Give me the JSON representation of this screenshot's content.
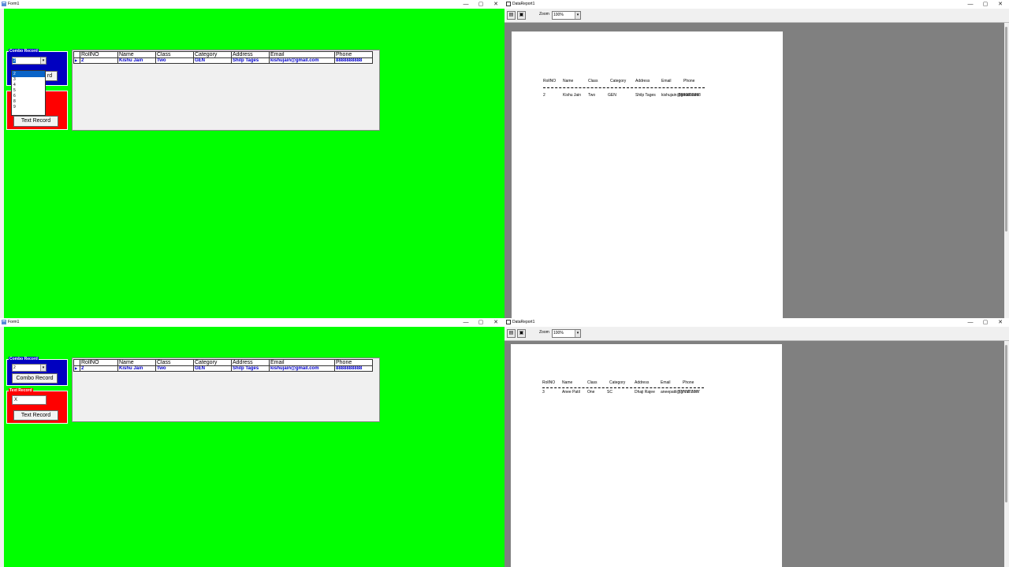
{
  "top": {
    "form": {
      "title": "Form1",
      "controls": {
        "minimize": "—",
        "maximize": "▢",
        "close": "✕"
      },
      "combo_frame": {
        "label": "Combo Record",
        "selected": "2",
        "button": "Combo Record",
        "button_visible_fragment": "rd"
      },
      "dropdown": {
        "options": [
          "2",
          "3",
          "4",
          "5",
          "6",
          "8",
          "9",
          "10"
        ],
        "selected_index": 0
      },
      "text_frame": {
        "label": "Text Record",
        "button": "Text Record"
      },
      "grid": {
        "indicator": "▶",
        "headers": [
          "RollNO",
          "Name",
          "Class",
          "Category",
          "Address",
          "Email",
          "Phone"
        ],
        "row": [
          "2",
          "Kishu Jain",
          "Two",
          "GEN",
          "Shilp Tages",
          "kishujain@gmail.com",
          "8888888888"
        ]
      }
    },
    "report": {
      "title": "DataReport1",
      "controls": {
        "minimize": "—",
        "maximize": "▢",
        "close": "✕"
      },
      "toolbar": {
        "print_icon": "printer-icon",
        "export_icon": "export-icon",
        "zoom_label": "Zoom",
        "zoom_value": "100%"
      },
      "headers": [
        "RollNO",
        "Name",
        "Class",
        "Category",
        "Address",
        "Email",
        "Phone"
      ],
      "row": [
        "2",
        "Kishu Jain",
        "Two",
        "GEN",
        "Shilp Tages",
        "kishujain@gmail.com",
        "8888888888"
      ]
    }
  },
  "bottom": {
    "form": {
      "title": "Form1",
      "controls": {
        "minimize": "—",
        "maximize": "▢",
        "close": "✕"
      },
      "combo_frame": {
        "label": "Combo Record",
        "selected": "2",
        "button": "Combo Record"
      },
      "text_frame": {
        "label": "Text Record",
        "input_value": "X",
        "button": "Text Record"
      },
      "grid": {
        "indicator": "▶",
        "headers": [
          "RollNO",
          "Name",
          "Class",
          "Category",
          "Address",
          "Email",
          "Phone"
        ],
        "row": [
          "2",
          "Kishu Jain",
          "Two",
          "GEN",
          "Shilp Tages",
          "kishujain@gmail.com",
          "8888888888"
        ]
      }
    },
    "report": {
      "title": "DataReport1",
      "controls": {
        "minimize": "—",
        "maximize": "▢",
        "close": "✕"
      },
      "toolbar": {
        "print_icon": "printer-icon",
        "export_icon": "export-icon",
        "zoom_label": "Zoom",
        "zoom_value": "100%"
      },
      "headers": [
        "RollNO",
        "Name",
        "Class",
        "Category",
        "Address",
        "Email",
        "Phone"
      ],
      "row": [
        "3",
        "Anee Patil",
        "One",
        "SC",
        "Dhaji Rajee",
        "aneepatil@gmail.com",
        "7777777777"
      ]
    }
  },
  "colors": {
    "form_bg": "#00ff00",
    "combo_frame": "#0000c0",
    "text_frame": "#ff0000",
    "report_bg": "#808080",
    "grid_text": "#0000cc"
  }
}
